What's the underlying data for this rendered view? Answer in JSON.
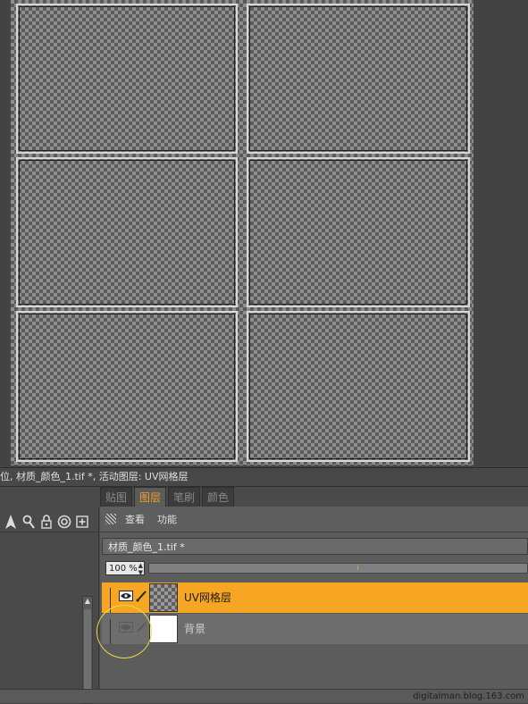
{
  "status_line": "位, 材质_颜色_1.tif *, 活动图层: UV网格层",
  "tabs": [
    {
      "label": "贴图",
      "active": false
    },
    {
      "label": "图层",
      "active": true
    },
    {
      "label": "笔刷",
      "active": false
    },
    {
      "label": "颜色",
      "active": false
    }
  ],
  "toolbar": {
    "view_label": "查看",
    "function_label": "功能"
  },
  "document_tab": "材质_颜色_1.tif *",
  "opacity": {
    "value": "100 %"
  },
  "layers": [
    {
      "name": "UV网格层",
      "selected": true,
      "visible": true
    },
    {
      "name": "背景",
      "selected": false,
      "visible": false
    }
  ],
  "tool_icons": [
    "arrow-select-icon",
    "magnifier-icon",
    "lock-icon",
    "target-icon",
    "add-icon"
  ],
  "watermark": "digitalman.blog.163.com",
  "colors": {
    "accent": "#f6a623",
    "active_tab_text": "#f0a020",
    "canvas_bg": "#434343"
  }
}
